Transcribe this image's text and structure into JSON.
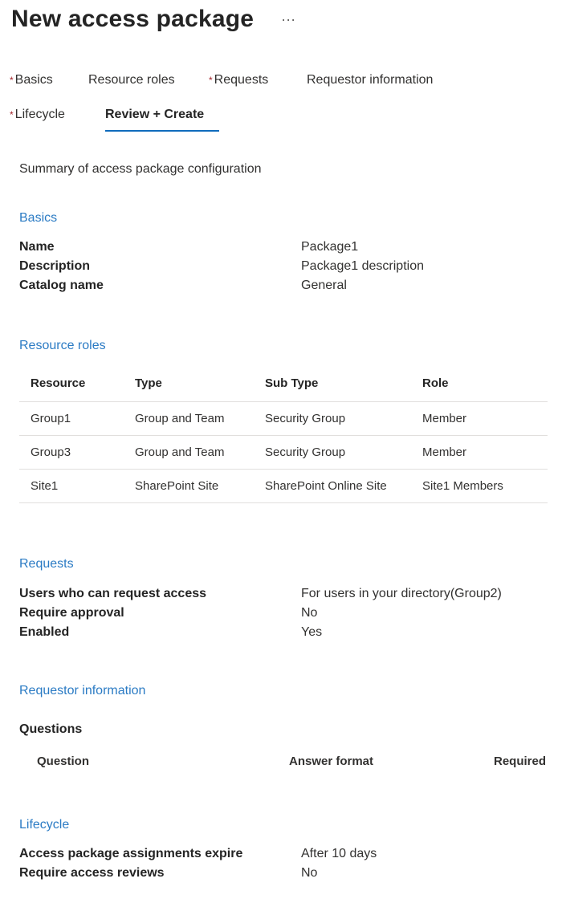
{
  "header": {
    "title": "New access package",
    "more_label": "···"
  },
  "tabs": [
    {
      "label": "Basics",
      "required": true
    },
    {
      "label": "Resource roles",
      "required": false
    },
    {
      "label": "Requests",
      "required": true
    },
    {
      "label": "Requestor information",
      "required": false
    },
    {
      "label": "Lifecycle",
      "required": true
    },
    {
      "label": "Review + Create",
      "required": false,
      "active": true
    }
  ],
  "required_marker": "*",
  "summary": "Summary of access package configuration",
  "basics": {
    "title": "Basics",
    "rows": [
      {
        "label": "Name",
        "value": "Package1"
      },
      {
        "label": "Description",
        "value": "Package1 description"
      },
      {
        "label": "Catalog name",
        "value": "General"
      }
    ]
  },
  "resource_roles": {
    "title": "Resource roles",
    "columns": [
      "Resource",
      "Type",
      "Sub Type",
      "Role"
    ],
    "rows": [
      [
        "Group1",
        "Group and Team",
        "Security Group",
        "Member"
      ],
      [
        "Group3",
        "Group and Team",
        "Security Group",
        "Member"
      ],
      [
        "Site1",
        "SharePoint Site",
        "SharePoint Online Site",
        "Site1 Members"
      ]
    ]
  },
  "requests": {
    "title": "Requests",
    "rows": [
      {
        "label": "Users who can request access",
        "value": "For users in your directory(Group2)"
      },
      {
        "label": "Require approval",
        "value": "No"
      },
      {
        "label": "Enabled",
        "value": "Yes"
      }
    ]
  },
  "requestor_information": {
    "title": "Requestor information",
    "questions_label": "Questions",
    "columns": [
      "Question",
      "Answer format",
      "Required"
    ]
  },
  "lifecycle": {
    "title": "Lifecycle",
    "rows": [
      {
        "label": "Access package assignments expire",
        "value": "After 10 days"
      },
      {
        "label": "Require access reviews",
        "value": "No"
      }
    ]
  },
  "colors": {
    "section_title": "#2b7bc4",
    "active_tab_underline": "#0f6cbd",
    "required_marker": "#a4262c"
  }
}
